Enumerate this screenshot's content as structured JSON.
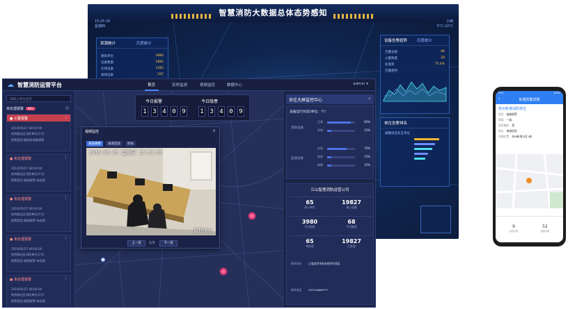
{
  "bigscreen": {
    "title": "智慧消防大数据总体态势感知",
    "left_info": [
      "15:25:30",
      "星期四"
    ],
    "right_info": [
      "小雨",
      "5°C-10°C"
    ],
    "left_panel": {
      "title": "资源统计",
      "tag": "月度统计",
      "rows": [
        {
          "label": "建筑单位",
          "value": "3880"
        },
        {
          "label": "设备数量",
          "value": "1882"
        },
        {
          "label": "在线设备",
          "value": "1585"
        },
        {
          "label": "离线设备",
          "value": "297"
        },
        {
          "label": "报警数量",
          "value": "0480"
        }
      ]
    },
    "right_panel": {
      "title": "设备告警趋势",
      "tag": "月度统计",
      "rows": [
        {
          "label": "告警总数",
          "value": "86"
        },
        {
          "label": "火警数量",
          "value": "28"
        },
        {
          "label": "处理率",
          "value": "75.4%"
        }
      ],
      "chart_label": "告警趋势"
    },
    "right_panel2": {
      "title": "单位告警排名",
      "subtitle": "报警排名前五单位"
    }
  },
  "front": {
    "logo_icon": "cloud-icon",
    "title": "智慧消防运营平台",
    "nav": [
      "首页",
      "实时监测",
      "视频监控",
      "数据中心"
    ],
    "admin": "admin ▾",
    "search_placeholder": "请输入单位名称",
    "alarm_header": "未处理报警",
    "alarm_count": "99+",
    "alarms": [
      {
        "title": "火警报警",
        "lines": [
          "2019/05/27 08:00:00",
          "南京路社区消防单位(1号)",
          "报警类型:烟感探测器报警"
        ]
      },
      {
        "title": "未处理报警",
        "lines": [
          "2019/05/27 08:00:00",
          "南京路社区消防单位(1号)",
          "报警类型:烟感报警 待处理"
        ]
      },
      {
        "title": "未处理报警",
        "lines": [
          "2019/05/27 08:00:00",
          "南京路社区消防单位(1号)",
          "报警类型:烟感报警 待处理"
        ]
      },
      {
        "title": "未处理报警",
        "lines": [
          "2019/05/27 08:00:00",
          "南京路社区消防单位(1号)",
          "报警类型:烟感报警 待处理"
        ]
      },
      {
        "title": "未处理报警",
        "lines": [
          "2019/05/27 08:00:00",
          "南京路社区消防单位(1号)",
          "报警类型:烟感报警 待处理"
        ]
      }
    ],
    "counter_today_alarm": "今日报警",
    "counter_today_hidden": "今日隐患",
    "digits_alarm": [
      "1",
      "3",
      "4",
      "0",
      "9"
    ],
    "digits_hidden": [
      "1",
      "3",
      "4",
      "0",
      "9"
    ],
    "video": {
      "title": "视频监控",
      "close": "×",
      "tabs": [
        "通道摄像",
        "通道回放",
        "抓拍"
      ],
      "timestamp": "2019-05-05 星期日 15:51:52",
      "channel_label": "监控中心",
      "prev": "上一页",
      "next": "下一页",
      "page": "1/3"
    },
    "right_head": "去往大屏监控中心",
    "right_arrow": "›",
    "stats_title": "设备运行状态(单位：个)",
    "stat_groups": [
      {
        "label": "消防设备",
        "rows": [
          {
            "name": "正常",
            "pct": "85%",
            "fill": 0.85
          },
          {
            "name": "异常",
            "pct": "15%",
            "fill": 0.15
          }
        ]
      },
      {
        "label": "监测设备",
        "rows": [
          {
            "name": "在线",
            "pct": "70%",
            "fill": 0.7
          },
          {
            "name": "离线",
            "pct": "15%",
            "fill": 0.15
          },
          {
            "name": "故障",
            "pct": "15%",
            "fill": 0.15
          }
        ]
      }
    ],
    "company": {
      "name": "江山智慧消防运营公司",
      "stats": [
        {
          "value": "65",
          "label": "接入单位"
        },
        {
          "value": "19827",
          "label": "接入设备"
        },
        {
          "value": "3980",
          "label": "今日巡查"
        },
        {
          "value": "68",
          "label": "今日维保"
        },
        {
          "value": "65",
          "label": "待处理"
        },
        {
          "value": "19827",
          "label": "已处理"
        }
      ],
      "address_label": "联系地址",
      "address": "江省金华市浙东经济开发区",
      "phone_label": "联系电话",
      "phone": "0579-8888****"
    }
  },
  "phone": {
    "status_left": "9:41",
    "status_right": "100%",
    "title": "处理告警详情",
    "back": "‹",
    "unit_name": "杭州新港消防单位",
    "rows": [
      {
        "label": "类型",
        "value": "烟感报警"
      },
      {
        "label": "等级",
        "value": "一级"
      },
      {
        "label": "是否确定",
        "value": "是"
      },
      {
        "label": "单位",
        "value": "南湖消防"
      },
      {
        "label": "详细位置",
        "value": "杭州新港小区1栋"
      }
    ],
    "foot": [
      {
        "value": "9",
        "label": "巡查次数"
      },
      {
        "value": "52",
        "label": "维保次数"
      }
    ]
  }
}
